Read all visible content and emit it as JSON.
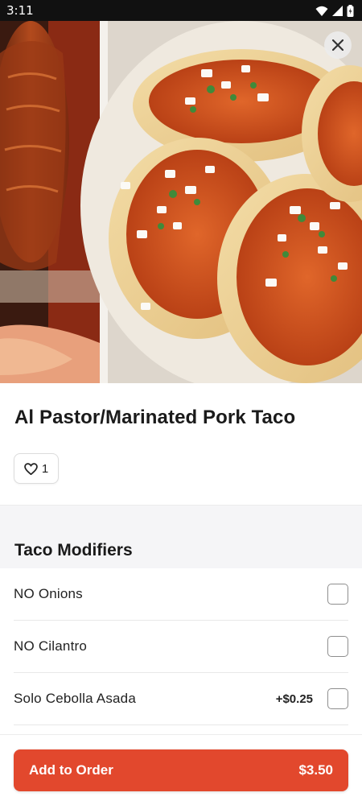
{
  "status_bar": {
    "time": "3:11"
  },
  "item": {
    "title": "Al Pastor/Marinated Pork Taco",
    "like_count": "1"
  },
  "modifiers": {
    "section_title": "Taco Modifiers",
    "options": [
      {
        "label": "NO Onions",
        "price": "",
        "checked": false
      },
      {
        "label": "NO Cilantro",
        "price": "",
        "checked": false
      },
      {
        "label": "Solo Cebolla Asada",
        "price": "+$0.25",
        "checked": false
      }
    ]
  },
  "order": {
    "button_label": "Add to Order",
    "total": "$3.50"
  },
  "colors": {
    "accent": "#e2482d",
    "section_bg": "#f5f5f7"
  },
  "icons": {
    "close": "close-icon",
    "like": "heart-icon"
  }
}
